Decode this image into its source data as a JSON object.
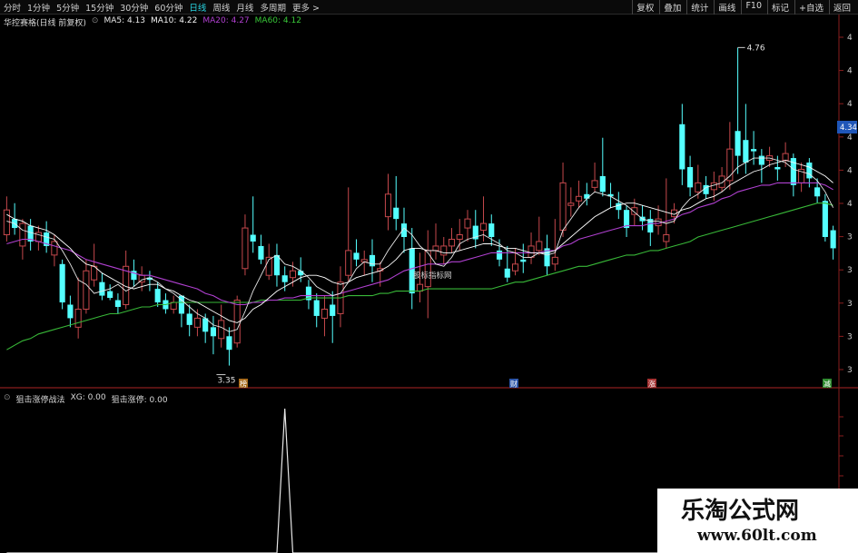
{
  "toolbar": {
    "periods": [
      "分时",
      "1分钟",
      "5分钟",
      "15分钟",
      "30分钟",
      "60分钟",
      "日线",
      "周线",
      "月线",
      "多周期",
      "更多 >"
    ],
    "active_period": "日线",
    "right_buttons": [
      "复权",
      "叠加",
      "统计",
      "画线",
      "F10",
      "标记",
      "+自选",
      "返回"
    ]
  },
  "header": {
    "title": "华控赛格(日线 前复权)",
    "ma5": "MA5: 4.13",
    "ma10": "MA10: 4.22",
    "ma20": "MA20: 4.27",
    "ma60": "MA60: 4.12"
  },
  "indicator": {
    "name": "狙击涨停战法",
    "xg": "XG: 0.00",
    "sniper": "狙击涨停: 0.00"
  },
  "annotations": {
    "high": "4.76",
    "low": "3.35",
    "right_price_tag": "4.34",
    "text_label": "股标指标网",
    "markers": [
      "榜",
      "财",
      "涨",
      "减"
    ]
  },
  "y_axis_ticks": [
    "4",
    "4",
    "4",
    "4",
    "4",
    "4",
    "3",
    "3",
    "3",
    "3",
    "3"
  ],
  "watermark": {
    "line1": "乐淘公式网",
    "line2": "www.60lt.com"
  },
  "colors": {
    "up": "#c5484c",
    "down": "#54ffff",
    "ma5": "#e8e8e8",
    "ma10": "#ffffff",
    "ma20": "#b040d0",
    "ma60": "#38b838",
    "separator": "#8a1e1e"
  },
  "chart_data": {
    "type": "candlestick",
    "price_range": [
      3.3,
      4.85
    ],
    "candles": [
      [
        3.93,
        4.04,
        4.1,
        3.9
      ],
      [
        4.0,
        3.96,
        4.07,
        3.93
      ],
      [
        3.88,
        3.98,
        4.0,
        3.82
      ],
      [
        3.97,
        3.9,
        4.0,
        3.86
      ],
      [
        3.9,
        3.94,
        3.97,
        3.86
      ],
      [
        3.94,
        3.88,
        3.99,
        3.85
      ],
      [
        3.84,
        3.9,
        3.93,
        3.79
      ],
      [
        3.8,
        3.63,
        3.82,
        3.6
      ],
      [
        3.62,
        3.56,
        3.66,
        3.52
      ],
      [
        3.52,
        3.6,
        3.74,
        3.47
      ],
      [
        3.6,
        3.77,
        3.82,
        3.58
      ],
      [
        3.73,
        3.79,
        3.89,
        3.7
      ],
      [
        3.72,
        3.66,
        3.76,
        3.64
      ],
      [
        3.68,
        3.65,
        3.71,
        3.64
      ],
      [
        3.64,
        3.61,
        3.67,
        3.58
      ],
      [
        3.62,
        3.79,
        3.86,
        3.6
      ],
      [
        3.77,
        3.73,
        3.82,
        3.7
      ],
      [
        3.72,
        3.75,
        3.79,
        3.68
      ],
      [
        3.74,
        3.73,
        3.77,
        3.68
      ],
      [
        3.69,
        3.63,
        3.72,
        3.61
      ],
      [
        3.64,
        3.6,
        3.67,
        3.58
      ],
      [
        3.6,
        3.63,
        3.66,
        3.58
      ],
      [
        3.66,
        3.58,
        3.66,
        3.52
      ],
      [
        3.58,
        3.53,
        3.62,
        3.48
      ],
      [
        3.52,
        3.56,
        3.6,
        3.48
      ],
      [
        3.56,
        3.5,
        3.58,
        3.45
      ],
      [
        3.52,
        3.48,
        3.57,
        3.4
      ],
      [
        3.47,
        3.55,
        3.62,
        3.43
      ],
      [
        3.48,
        3.42,
        3.52,
        3.35
      ],
      [
        3.45,
        3.64,
        3.66,
        3.43
      ],
      [
        3.78,
        3.96,
        4.02,
        3.75
      ],
      [
        3.93,
        3.9,
        4.1,
        3.85
      ],
      [
        3.88,
        3.82,
        3.93,
        3.8
      ],
      [
        3.75,
        3.83,
        3.89,
        3.73
      ],
      [
        3.84,
        3.75,
        3.89,
        3.7
      ],
      [
        3.75,
        3.72,
        3.79,
        3.68
      ],
      [
        3.74,
        3.77,
        3.81,
        3.7
      ],
      [
        3.77,
        3.75,
        3.83,
        3.72
      ],
      [
        3.7,
        3.64,
        3.73,
        3.6
      ],
      [
        3.64,
        3.57,
        3.67,
        3.52
      ],
      [
        3.56,
        3.6,
        3.66,
        3.48
      ],
      [
        3.62,
        3.57,
        3.68,
        3.45
      ],
      [
        3.58,
        3.72,
        3.79,
        3.52
      ],
      [
        3.75,
        3.86,
        4.14,
        3.72
      ],
      [
        3.85,
        3.82,
        3.91,
        3.79
      ],
      [
        3.81,
        3.82,
        3.86,
        3.75
      ],
      [
        3.84,
        3.79,
        3.91,
        3.72
      ],
      [
        3.77,
        3.78,
        3.81,
        3.7
      ],
      [
        4.01,
        4.11,
        4.2,
        3.95
      ],
      [
        4.05,
        4.0,
        4.19,
        3.95
      ],
      [
        3.98,
        3.92,
        4.05,
        3.85
      ],
      [
        3.87,
        3.67,
        3.96,
        3.6
      ],
      [
        3.68,
        3.71,
        3.85,
        3.63
      ],
      [
        3.7,
        3.86,
        3.95,
        3.56
      ],
      [
        3.86,
        3.88,
        3.98,
        3.82
      ],
      [
        3.84,
        3.88,
        3.92,
        3.8
      ],
      [
        3.88,
        3.91,
        3.96,
        3.85
      ],
      [
        3.91,
        3.93,
        4.0,
        3.86
      ],
      [
        3.96,
        4.0,
        4.04,
        3.9
      ],
      [
        3.97,
        3.91,
        4.04,
        3.87
      ],
      [
        3.95,
        3.98,
        4.1,
        3.9
      ],
      [
        3.98,
        3.92,
        4.02,
        3.88
      ],
      [
        3.86,
        3.82,
        3.91,
        3.79
      ],
      [
        3.78,
        3.74,
        3.88,
        3.72
      ],
      [
        3.77,
        3.8,
        3.87,
        3.75
      ],
      [
        3.82,
        3.81,
        3.89,
        3.76
      ],
      [
        3.83,
        3.88,
        3.94,
        3.8
      ],
      [
        3.86,
        3.9,
        4.01,
        3.84
      ],
      [
        3.87,
        3.79,
        3.93,
        3.75
      ],
      [
        3.8,
        3.83,
        4.0,
        3.77
      ],
      [
        3.95,
        4.16,
        4.25,
        3.92
      ],
      [
        4.06,
        4.07,
        4.14,
        4.01
      ],
      [
        4.08,
        4.1,
        4.17,
        4.05
      ],
      [
        4.11,
        4.09,
        4.16,
        4.06
      ],
      [
        4.14,
        4.17,
        4.25,
        4.12
      ],
      [
        4.19,
        4.12,
        4.36,
        4.1
      ],
      [
        4.11,
        4.1,
        4.16,
        4.05
      ],
      [
        4.07,
        4.04,
        4.12,
        4.0
      ],
      [
        4.04,
        3.96,
        4.06,
        3.92
      ],
      [
        4.02,
        4.05,
        4.09,
        3.97
      ],
      [
        4.01,
        3.99,
        4.06,
        3.95
      ],
      [
        4.0,
        3.94,
        4.04,
        3.88
      ],
      [
        3.97,
        4.0,
        4.06,
        3.93
      ],
      [
        3.9,
        3.93,
        4.18,
        3.87
      ],
      [
        4.01,
        4.04,
        4.07,
        3.98
      ],
      [
        4.42,
        4.22,
        4.51,
        4.15
      ],
      [
        4.23,
        4.14,
        4.28,
        4.1
      ],
      [
        4.12,
        4.16,
        4.24,
        4.09
      ],
      [
        4.15,
        4.11,
        4.19,
        4.09
      ],
      [
        4.13,
        4.16,
        4.21,
        4.08
      ],
      [
        4.14,
        4.19,
        4.23,
        4.12
      ],
      [
        4.17,
        4.31,
        4.43,
        4.13
      ],
      [
        4.39,
        4.28,
        4.76,
        4.2
      ],
      [
        4.35,
        4.25,
        4.51,
        4.2
      ],
      [
        4.31,
        4.3,
        4.39,
        4.24
      ],
      [
        4.28,
        4.24,
        4.31,
        4.16
      ],
      [
        4.26,
        4.28,
        4.32,
        4.23
      ],
      [
        4.23,
        4.22,
        4.28,
        4.17
      ],
      [
        4.26,
        4.29,
        4.34,
        4.23
      ],
      [
        4.27,
        4.15,
        4.29,
        4.1
      ],
      [
        4.16,
        4.22,
        4.25,
        4.12
      ],
      [
        4.25,
        4.18,
        4.27,
        4.14
      ],
      [
        4.14,
        4.1,
        4.18,
        4.07
      ],
      [
        4.08,
        3.92,
        4.11,
        3.9
      ],
      [
        3.95,
        3.87,
        3.97,
        3.82
      ]
    ],
    "ma5": [
      3.99,
      3.98,
      3.95,
      3.94,
      3.93,
      3.92,
      3.91,
      3.86,
      3.8,
      3.73,
      3.71,
      3.67,
      3.68,
      3.69,
      3.71,
      3.68,
      3.7,
      3.73,
      3.74,
      3.72,
      3.69,
      3.67,
      3.64,
      3.61,
      3.58,
      3.56,
      3.53,
      3.52,
      3.5,
      3.51,
      3.59,
      3.68,
      3.75,
      3.82,
      3.84,
      3.8,
      3.79,
      3.77,
      3.74,
      3.7,
      3.68,
      3.66,
      3.67,
      3.72,
      3.78,
      3.81,
      3.8,
      3.8,
      3.86,
      3.91,
      3.96,
      3.93,
      3.88,
      3.85,
      3.8,
      3.79,
      3.83,
      3.89,
      3.91,
      3.92,
      3.93,
      3.91,
      3.89,
      3.86,
      3.85,
      3.83,
      3.83,
      3.85,
      3.84,
      3.85,
      3.95,
      4.0,
      4.05,
      4.09,
      4.12,
      4.11,
      4.1,
      4.08,
      4.06,
      4.03,
      4.0,
      3.99,
      3.99,
      3.98,
      3.99,
      4.05,
      4.09,
      4.11,
      4.14,
      4.15,
      4.16,
      4.19,
      4.23,
      4.25,
      4.27,
      4.27,
      4.27,
      4.26,
      4.25,
      4.22,
      4.21,
      4.2,
      4.17,
      4.12,
      4.05
    ],
    "ma10": [
      4.02,
      4.0,
      3.99,
      3.97,
      3.96,
      3.95,
      3.93,
      3.9,
      3.87,
      3.83,
      3.8,
      3.79,
      3.76,
      3.74,
      3.72,
      3.7,
      3.69,
      3.7,
      3.71,
      3.71,
      3.69,
      3.68,
      3.66,
      3.64,
      3.63,
      3.61,
      3.59,
      3.57,
      3.55,
      3.54,
      3.56,
      3.6,
      3.62,
      3.65,
      3.68,
      3.7,
      3.72,
      3.74,
      3.75,
      3.75,
      3.74,
      3.72,
      3.71,
      3.72,
      3.74,
      3.75,
      3.76,
      3.77,
      3.79,
      3.82,
      3.86,
      3.87,
      3.87,
      3.86,
      3.86,
      3.85,
      3.85,
      3.86,
      3.87,
      3.88,
      3.89,
      3.89,
      3.88,
      3.87,
      3.87,
      3.86,
      3.85,
      3.85,
      3.85,
      3.86,
      3.89,
      3.92,
      3.95,
      3.98,
      4.01,
      4.03,
      4.05,
      4.06,
      4.07,
      4.07,
      4.06,
      4.05,
      4.04,
      4.03,
      4.02,
      4.04,
      4.05,
      4.07,
      4.09,
      4.1,
      4.12,
      4.15,
      4.17,
      4.19,
      4.21,
      4.22,
      4.24,
      4.25,
      4.26,
      4.25,
      4.24,
      4.23,
      4.21,
      4.19,
      4.16
    ],
    "ma20": [
      3.89,
      3.9,
      3.91,
      3.91,
      3.9,
      3.89,
      3.88,
      3.87,
      3.86,
      3.84,
      3.82,
      3.81,
      3.8,
      3.79,
      3.78,
      3.77,
      3.76,
      3.75,
      3.75,
      3.74,
      3.73,
      3.72,
      3.71,
      3.7,
      3.69,
      3.67,
      3.66,
      3.64,
      3.63,
      3.62,
      3.62,
      3.63,
      3.63,
      3.64,
      3.64,
      3.65,
      3.65,
      3.66,
      3.66,
      3.66,
      3.66,
      3.66,
      3.67,
      3.68,
      3.69,
      3.7,
      3.71,
      3.72,
      3.73,
      3.75,
      3.77,
      3.78,
      3.79,
      3.8,
      3.8,
      3.8,
      3.81,
      3.81,
      3.82,
      3.83,
      3.84,
      3.85,
      3.85,
      3.85,
      3.85,
      3.85,
      3.85,
      3.85,
      3.86,
      3.86,
      3.88,
      3.89,
      3.91,
      3.92,
      3.93,
      3.94,
      3.95,
      3.96,
      3.97,
      3.97,
      3.97,
      3.98,
      3.98,
      3.99,
      4.0,
      4.02,
      4.03,
      4.05,
      4.06,
      4.07,
      4.09,
      4.1,
      4.12,
      4.13,
      4.14,
      4.15,
      4.15,
      4.16,
      4.16,
      4.16,
      4.16,
      4.16,
      4.16,
      4.15,
      4.13
    ],
    "ma60": [
      3.42,
      3.44,
      3.46,
      3.47,
      3.49,
      3.5,
      3.51,
      3.52,
      3.53,
      3.54,
      3.55,
      3.56,
      3.57,
      3.58,
      3.58,
      3.59,
      3.6,
      3.61,
      3.61,
      3.62,
      3.62,
      3.63,
      3.63,
      3.63,
      3.63,
      3.63,
      3.63,
      3.63,
      3.63,
      3.63,
      3.63,
      3.63,
      3.64,
      3.64,
      3.64,
      3.64,
      3.64,
      3.64,
      3.65,
      3.65,
      3.65,
      3.65,
      3.65,
      3.66,
      3.66,
      3.66,
      3.66,
      3.67,
      3.67,
      3.68,
      3.68,
      3.68,
      3.68,
      3.69,
      3.69,
      3.69,
      3.69,
      3.69,
      3.69,
      3.69,
      3.69,
      3.69,
      3.7,
      3.71,
      3.72,
      3.72,
      3.73,
      3.74,
      3.75,
      3.76,
      3.77,
      3.78,
      3.79,
      3.79,
      3.8,
      3.81,
      3.82,
      3.83,
      3.84,
      3.84,
      3.85,
      3.86,
      3.86,
      3.87,
      3.88,
      3.89,
      3.9,
      3.92,
      3.93,
      3.94,
      3.95,
      3.96,
      3.97,
      3.98,
      3.99,
      4.0,
      4.01,
      4.02,
      4.03,
      4.04,
      4.05,
      4.06,
      4.07,
      4.07,
      4.06
    ],
    "indicator_series": [
      0,
      0,
      0,
      0,
      0,
      0,
      0,
      0,
      0,
      0,
      0,
      0,
      0,
      0,
      0,
      0,
      0,
      0,
      0,
      0,
      0,
      0,
      0,
      0,
      0,
      0,
      0,
      0,
      0,
      0,
      0,
      0,
      0,
      0,
      0,
      1,
      0,
      0,
      0,
      0,
      0,
      0,
      0,
      0,
      0,
      0,
      0,
      0,
      0,
      0,
      0,
      0,
      0,
      0,
      0,
      0,
      0,
      0,
      0,
      0,
      0,
      0,
      0,
      0,
      0,
      0,
      0,
      0,
      0,
      0,
      0,
      0,
      0,
      0,
      0,
      0,
      0,
      0,
      0,
      0,
      0,
      0,
      0,
      0,
      0,
      0,
      0,
      0,
      0,
      0,
      0,
      0,
      0,
      0,
      0,
      0,
      0,
      0,
      0,
      0,
      0,
      0,
      0,
      0,
      0
    ],
    "indicator_range": [
      0,
      1
    ]
  }
}
